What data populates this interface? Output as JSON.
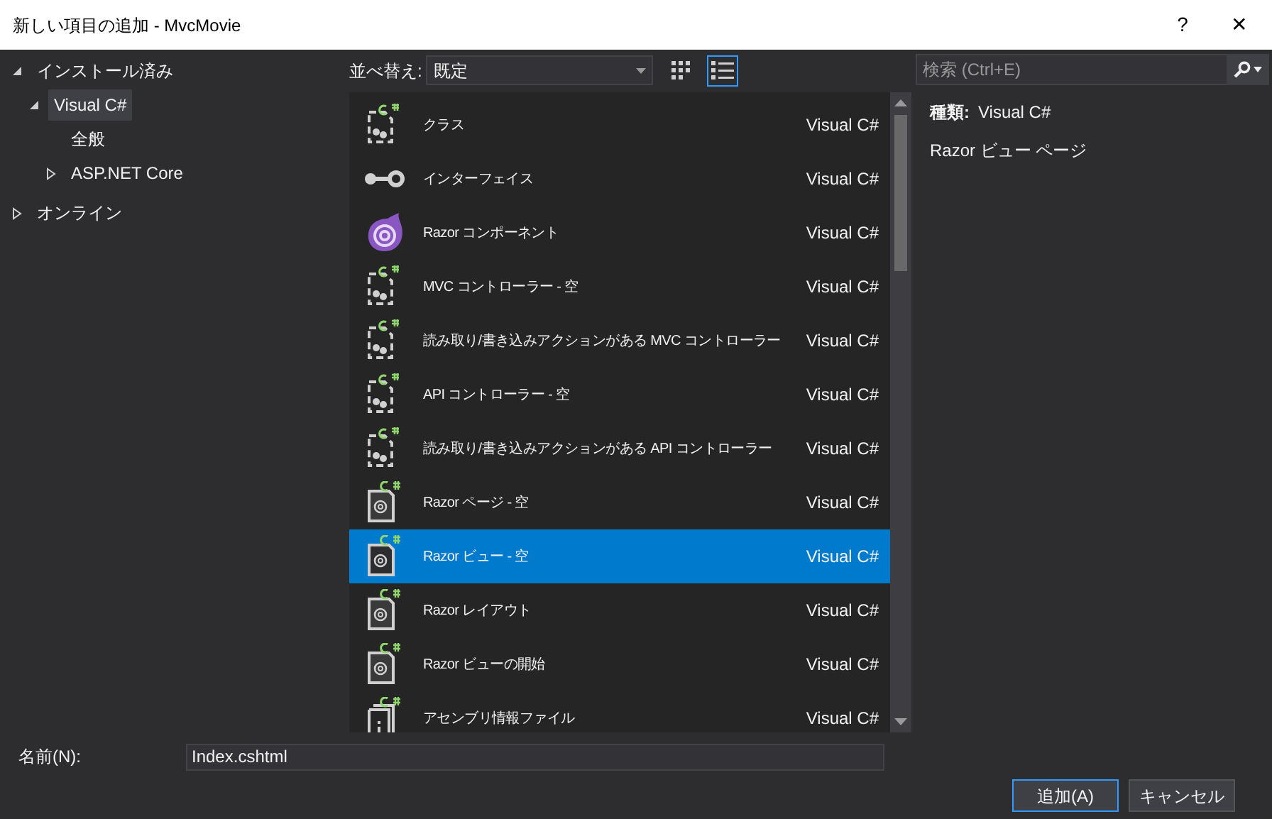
{
  "window": {
    "title": "新しい項目の追加 - MvcMovie",
    "help": "?",
    "close": "✕"
  },
  "tree": [
    {
      "label": "インストール済み",
      "expanded": true,
      "selected": false,
      "children": [
        {
          "label": "Visual C#",
          "expanded": true,
          "selected": true,
          "children": [
            {
              "label": "全般",
              "selected": false
            },
            {
              "label": "ASP.NET Core",
              "expanded": false,
              "selected": false
            }
          ]
        }
      ]
    },
    {
      "label": "オンライン",
      "expanded": false,
      "selected": false
    }
  ],
  "sort": {
    "label": "並べ替え:",
    "value": "既定"
  },
  "view_modes": [
    {
      "kind": "grid",
      "selected": false
    },
    {
      "kind": "list",
      "selected": true
    }
  ],
  "templates": [
    {
      "kind": "class",
      "name": "クラス",
      "language": "Visual C#",
      "selected": false
    },
    {
      "kind": "interface",
      "name": "インターフェイス",
      "language": "Visual C#",
      "selected": false
    },
    {
      "kind": "component",
      "name": "Razor コンポーネント",
      "language": "Visual C#",
      "selected": false
    },
    {
      "kind": "class",
      "name": "MVC コントローラー - 空",
      "language": "Visual C#",
      "selected": false
    },
    {
      "kind": "class",
      "name": "読み取り/書き込みアクションがある MVC コントローラー",
      "language": "Visual C#",
      "selected": false
    },
    {
      "kind": "class",
      "name": "API コントローラー - 空",
      "language": "Visual C#",
      "selected": false
    },
    {
      "kind": "class",
      "name": "読み取り/書き込みアクションがある API コントローラー",
      "language": "Visual C#",
      "selected": false
    },
    {
      "kind": "razor",
      "name": "Razor ページ - 空",
      "language": "Visual C#",
      "selected": false
    },
    {
      "kind": "razor",
      "name": "Razor ビュー - 空",
      "language": "Visual C#",
      "selected": true
    },
    {
      "kind": "razor",
      "name": "Razor レイアウト",
      "language": "Visual C#",
      "selected": false
    },
    {
      "kind": "razor",
      "name": "Razor ビューの開始",
      "language": "Visual C#",
      "selected": false
    },
    {
      "kind": "info",
      "name": "アセンブリ情報ファイル",
      "language": "Visual C#",
      "selected": false
    }
  ],
  "search": {
    "placeholder": "検索 (Ctrl+E)"
  },
  "details": {
    "type_label": "種類:",
    "type_value": "Visual C#",
    "description": "Razor ビュー ページ"
  },
  "name_field": {
    "label": "名前(N):",
    "value": "Index.cshtml"
  },
  "buttons": [
    {
      "label": "追加(A)",
      "default": true
    },
    {
      "label": "キャンセル",
      "default": false
    }
  ]
}
